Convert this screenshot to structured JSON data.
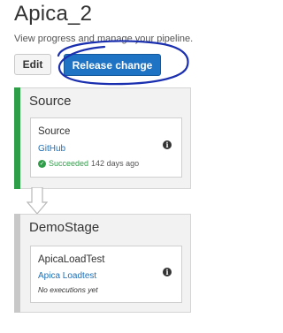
{
  "page": {
    "title": "Apica_2",
    "subtitle": "View progress and manage your pipeline."
  },
  "toolbar": {
    "edit_label": "Edit",
    "release_label": "Release change"
  },
  "stages": [
    {
      "name": "Source",
      "status_color": "#2f9e48",
      "action": {
        "name": "Source",
        "provider": "GitHub",
        "status_icon": "check-circle-icon",
        "status": "Succeeded",
        "age": "142 days ago"
      }
    },
    {
      "name": "DemoStage",
      "status_color": "#c8c8c8",
      "action": {
        "name": "ApicaLoadTest",
        "provider": "Apica Loadtest",
        "execution_note": "No executions yet"
      }
    }
  ],
  "icons": {
    "info": "info-icon",
    "transition": "down-arrow-icon"
  },
  "colors": {
    "primary_button": "#1f73c4",
    "annotation_ink": "#1a2fb0",
    "success": "#2f9e48",
    "link": "#1f6fb5"
  }
}
